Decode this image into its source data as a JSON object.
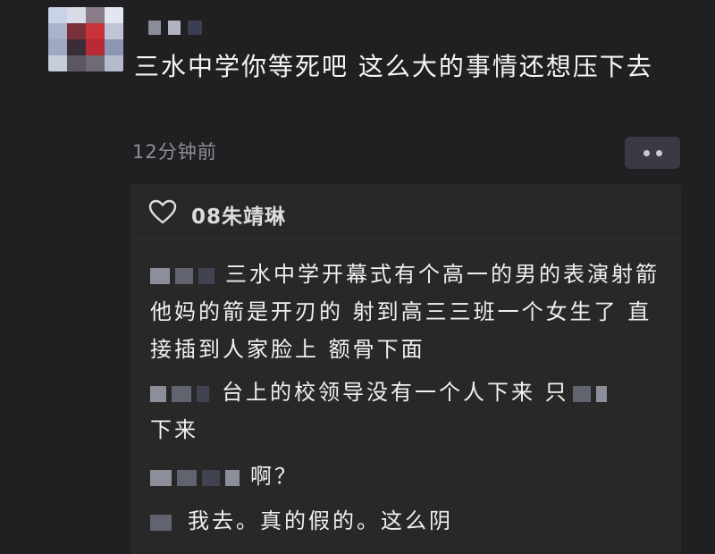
{
  "post": {
    "text": "三水中学你等死吧 这么大的事情还想压下去",
    "time": "12分钟前"
  },
  "likes": {
    "icon": "heart-icon",
    "user": "08朱靖琳"
  },
  "comments": [
    {
      "text": "三水中学开幕式有个高一的男的表演射箭 他妈的箭是开刃的 射到高三三班一个女生了 直接插到人家脸上 额骨下面"
    },
    {
      "text": "台上的校领导没有一个人下来 只",
      "tail": "下来"
    },
    {
      "text": "啊？"
    },
    {
      "text": "我去。真的假的。这么阴"
    }
  ],
  "colors": {
    "background": "#202022",
    "panel": "#282829",
    "more_button": "#3a3a44"
  }
}
